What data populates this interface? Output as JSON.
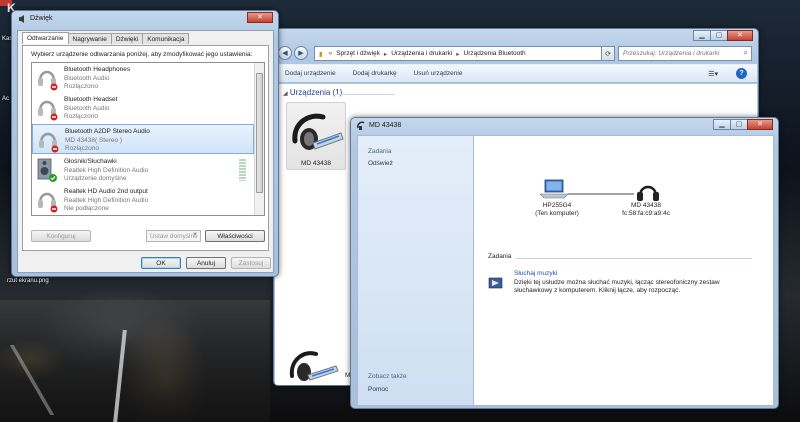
{
  "desktop": {
    "label_top_left": "Kas",
    "label_mid_left": "Ac",
    "file_label": "rzut ekranu.png"
  },
  "explorer": {
    "breadcrumb": [
      "Sprzęt i dźwięk",
      "Urządzenia i drukarki",
      "Urządzenia Bluetooth"
    ],
    "search_placeholder": "Przeszukaj: Urządzenia i drukarki",
    "toolbar": {
      "add_device": "Dodaj urządzenie",
      "add_printer": "Dodaj drukarkę",
      "remove_device": "Usuń urządzenie"
    },
    "group_header": "Urządzenia (1)",
    "device_label": "MD 43438",
    "partial_label": "MD 43"
  },
  "bluetooth": {
    "title": "MD 43438",
    "left": {
      "tasks_header": "Zadania",
      "refresh": "Odśwież",
      "see_also": "Zobacz także",
      "help": "Pomoc"
    },
    "computer": {
      "name": "HP255G4",
      "subtitle": "(Ten komputer)"
    },
    "headset": {
      "name": "MD 43438",
      "address": "fc:58:fa:c9:a9:4c"
    },
    "tasks_section": "Zadania",
    "task_link": "Słuchaj muzyki",
    "task_desc": "Dzięki tej usłudze można słuchać muzyki, łącząc stereofoniczny zestaw słuchawkowy z komputerem. Kliknij łącze, aby rozpocząć."
  },
  "sound": {
    "title": "Dźwięk",
    "tabs": [
      "Odtwarzanie",
      "Nagrywanie",
      "Dźwięki",
      "Komunikacja"
    ],
    "instruction": "Wybierz urządzenie odtwarzania poniżej, aby zmodyfikować jego ustawienia:",
    "devices": [
      {
        "name": "Bluetooth Headphones",
        "type": "Bluetooth Audio",
        "status": "Rozłączono"
      },
      {
        "name": "Bluetooth Headset",
        "type": "Bluetooth Audio",
        "status": "Rozłączono"
      },
      {
        "name": "Bluetooth A2DP Stereo Audio",
        "type": "MD 43438( Stereo )",
        "status": "Rozłączono"
      },
      {
        "name": "Głośnik/Słuchawki",
        "type": "Realtek High Definition Audio",
        "status": "Urządzenie domyślne"
      },
      {
        "name": "Realtek HD Audio 2nd output",
        "type": "Realtek High Definition Audio",
        "status": "Nie podłączone"
      }
    ],
    "configure": "Konfiguruj",
    "set_default": "Ustaw domyślne",
    "properties": "Właściwości",
    "ok": "OK",
    "cancel": "Anuluj",
    "apply": "Zastosuj"
  },
  "colors": {
    "accent_link": "#1a52b2",
    "group_header": "#1e3f92",
    "selection": "#cfe4fb",
    "status_disconnected": "#cc2222",
    "status_default": "#2e9d2e"
  }
}
